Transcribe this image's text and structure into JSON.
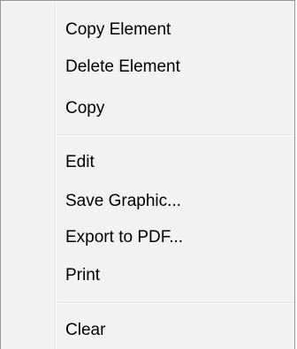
{
  "context_menu": {
    "groups": [
      {
        "items": [
          {
            "label": "Copy Element"
          },
          {
            "label": "Delete Element"
          },
          {
            "label": "Copy"
          }
        ]
      },
      {
        "items": [
          {
            "label": "Edit"
          },
          {
            "label": "Save Graphic..."
          },
          {
            "label": "Export to PDF..."
          },
          {
            "label": "Print"
          }
        ]
      },
      {
        "items": [
          {
            "label": "Clear"
          }
        ]
      }
    ]
  }
}
